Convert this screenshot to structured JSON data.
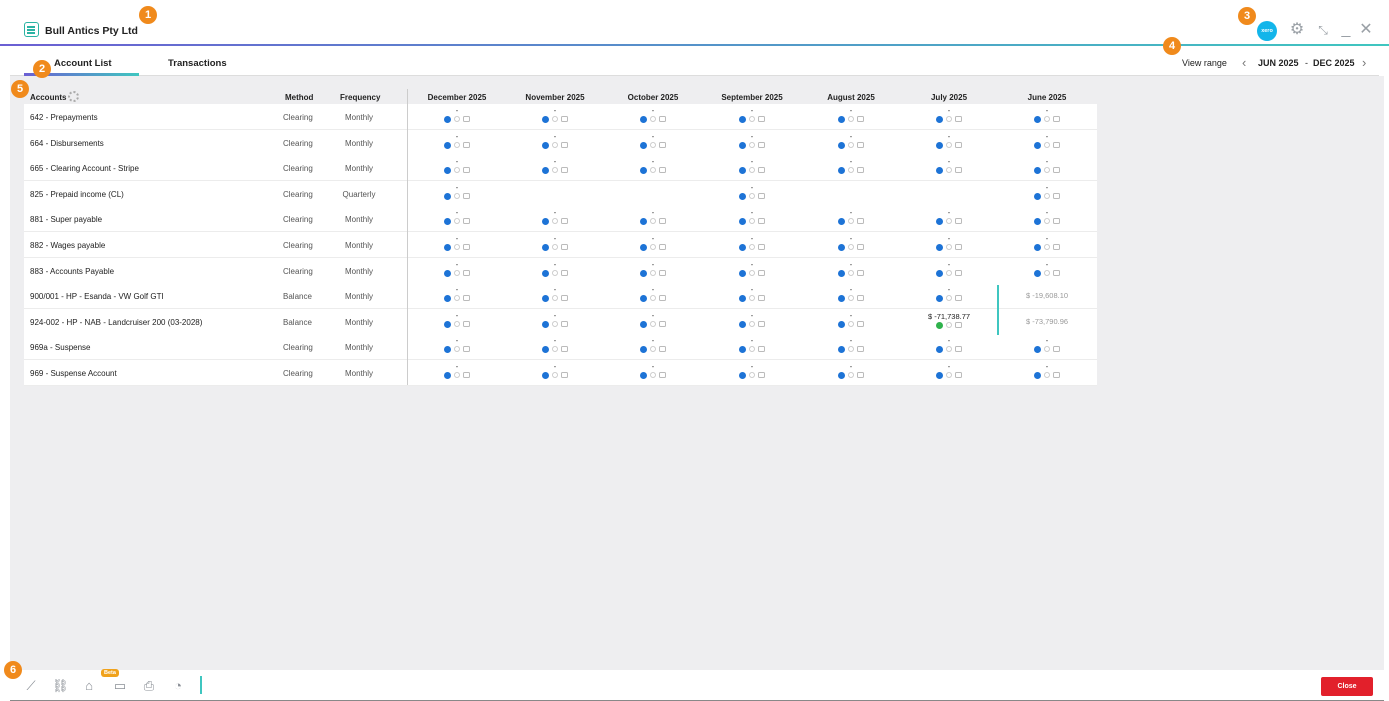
{
  "header": {
    "company": "Bull Antics Pty Ltd",
    "xero_label": "xero"
  },
  "badges": [
    "1",
    "2",
    "3",
    "4",
    "5",
    "6"
  ],
  "tabs": [
    {
      "label": "Account List",
      "active": true
    },
    {
      "label": "Transactions",
      "active": false
    }
  ],
  "range": {
    "label": "View range",
    "start": "JUN 2025",
    "separator": "-",
    "end": "DEC 2025"
  },
  "columns": {
    "accounts": "Accounts",
    "method": "Method",
    "frequency": "Frequency",
    "months": [
      "December 2025",
      "November 2025",
      "October 2025",
      "September 2025",
      "August 2025",
      "July 2025",
      "June 2025"
    ]
  },
  "rows": [
    {
      "name": "642 - Prepayments",
      "method": "Clearing",
      "frequency": "Monthly",
      "cells": [
        {
          "t": "std"
        },
        {
          "t": "std"
        },
        {
          "t": "std"
        },
        {
          "t": "std"
        },
        {
          "t": "std"
        },
        {
          "t": "std"
        },
        {
          "t": "std"
        }
      ]
    },
    {
      "name": "664 - Disbursements",
      "method": "Clearing",
      "frequency": "Monthly",
      "cells": [
        {
          "t": "std"
        },
        {
          "t": "std"
        },
        {
          "t": "std"
        },
        {
          "t": "std"
        },
        {
          "t": "std"
        },
        {
          "t": "std"
        },
        {
          "t": "std"
        }
      ]
    },
    {
      "name": "665 - Clearing Account - Stripe",
      "method": "Clearing",
      "frequency": "Monthly",
      "cells": [
        {
          "t": "std"
        },
        {
          "t": "std"
        },
        {
          "t": "std"
        },
        {
          "t": "std"
        },
        {
          "t": "std"
        },
        {
          "t": "std"
        },
        {
          "t": "std"
        }
      ]
    },
    {
      "name": "825 - Prepaid income (CL)",
      "method": "Clearing",
      "frequency": "Quarterly",
      "cells": [
        {
          "t": "std"
        },
        {
          "t": "empty"
        },
        {
          "t": "empty"
        },
        {
          "t": "std"
        },
        {
          "t": "empty"
        },
        {
          "t": "empty"
        },
        {
          "t": "std"
        }
      ]
    },
    {
      "name": "881 - Super payable",
      "method": "Clearing",
      "frequency": "Monthly",
      "cells": [
        {
          "t": "std"
        },
        {
          "t": "std"
        },
        {
          "t": "std"
        },
        {
          "t": "std"
        },
        {
          "t": "std"
        },
        {
          "t": "std"
        },
        {
          "t": "std"
        }
      ]
    },
    {
      "name": "882 - Wages payable",
      "method": "Clearing",
      "frequency": "Monthly",
      "cells": [
        {
          "t": "std"
        },
        {
          "t": "std"
        },
        {
          "t": "std"
        },
        {
          "t": "std"
        },
        {
          "t": "std"
        },
        {
          "t": "std"
        },
        {
          "t": "std"
        }
      ]
    },
    {
      "name": "883 - Accounts Payable",
      "method": "Clearing",
      "frequency": "Monthly",
      "cells": [
        {
          "t": "std"
        },
        {
          "t": "std"
        },
        {
          "t": "std"
        },
        {
          "t": "std"
        },
        {
          "t": "std"
        },
        {
          "t": "std"
        },
        {
          "t": "std"
        }
      ]
    },
    {
      "name": "900/001 - HP - Esanda - VW Golf GTI",
      "method": "Balance",
      "frequency": "Monthly",
      "cells": [
        {
          "t": "std"
        },
        {
          "t": "std"
        },
        {
          "t": "std"
        },
        {
          "t": "std"
        },
        {
          "t": "std"
        },
        {
          "t": "std"
        },
        {
          "t": "faded",
          "text": "$ -19,608.10"
        }
      ]
    },
    {
      "name": "924-002 - HP - NAB - Landcruiser 200 (03-2028)",
      "method": "Balance",
      "frequency": "Monthly",
      "cells": [
        {
          "t": "std"
        },
        {
          "t": "std"
        },
        {
          "t": "std"
        },
        {
          "t": "std"
        },
        {
          "t": "std"
        },
        {
          "t": "amount",
          "text": "$ -71,738.77"
        },
        {
          "t": "faded",
          "text": "$ -73,790.96"
        }
      ]
    },
    {
      "name": "969a - Suspense",
      "method": "Clearing",
      "frequency": "Monthly",
      "cells": [
        {
          "t": "std"
        },
        {
          "t": "std"
        },
        {
          "t": "std"
        },
        {
          "t": "std"
        },
        {
          "t": "std"
        },
        {
          "t": "std"
        },
        {
          "t": "std"
        }
      ]
    },
    {
      "name": "969 - Suspense Account",
      "method": "Clearing",
      "frequency": "Monthly",
      "cells": [
        {
          "t": "std"
        },
        {
          "t": "std"
        },
        {
          "t": "std"
        },
        {
          "t": "std"
        },
        {
          "t": "std"
        },
        {
          "t": "std"
        },
        {
          "t": "std"
        }
      ]
    }
  ],
  "cell_dash": "-",
  "footer": {
    "beta": "Beta",
    "close": "Close",
    "icons": [
      "chart-icon",
      "link-icon",
      "tag-icon",
      "chat-icon",
      "print-icon",
      "pie-icon"
    ]
  },
  "colors": {
    "accent_start": "#6b5fd3",
    "accent_end": "#3fc6c0",
    "dot_blue": "#1d73d6",
    "dot_green": "#2fb24c",
    "close_red": "#e2202b",
    "badge_orange": "#f08a1c"
  }
}
